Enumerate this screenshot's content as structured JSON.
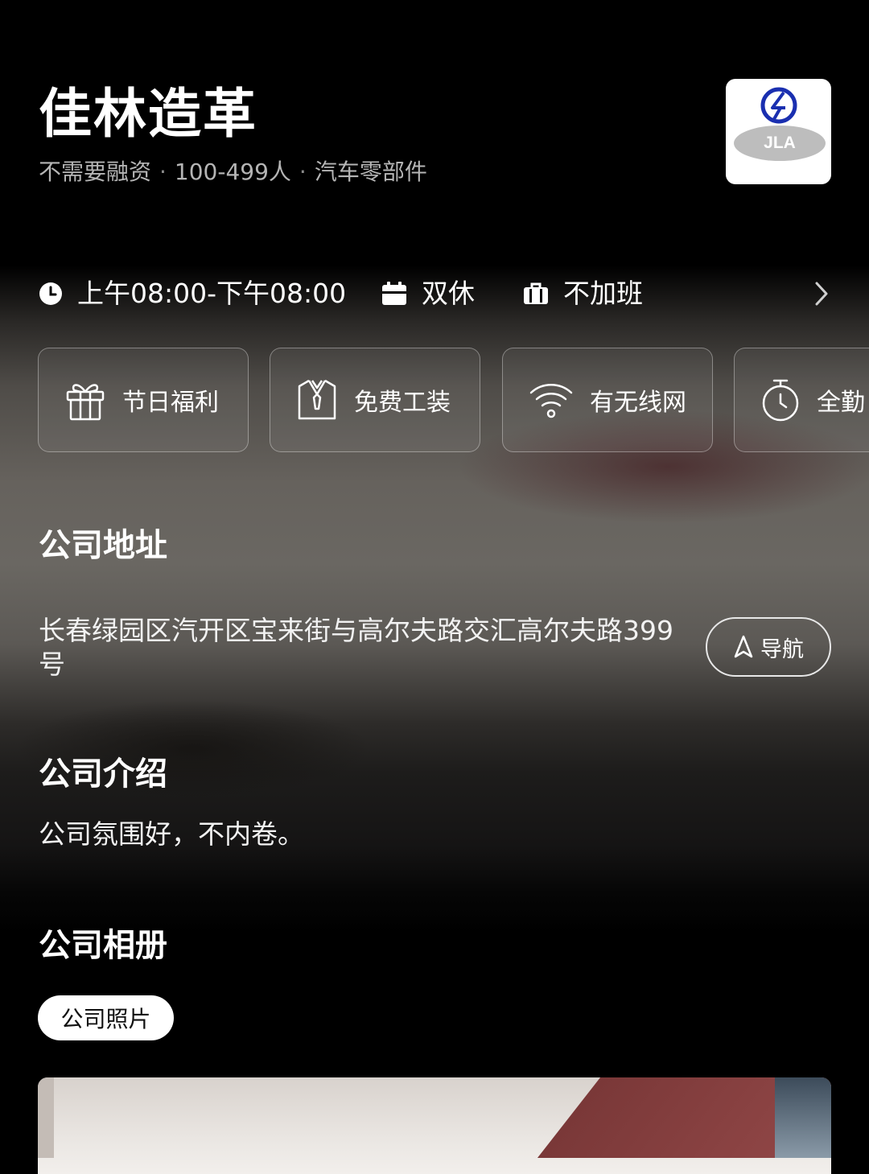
{
  "company": {
    "name": "佳林造革",
    "funding": "不需要融资",
    "size": "100-499人",
    "industry": "汽车零部件",
    "meta_separator": "·",
    "logo": {
      "text": "JLA",
      "icon": "jla-logo-icon",
      "brand_color": "#1a2fb0",
      "oval_color": "#bdbdbd"
    }
  },
  "work_info": {
    "hours": "上午08:00-下午08:00",
    "rest": "双休",
    "overtime": "不加班",
    "icons": [
      "clock-icon",
      "calendar-icon",
      "briefcase-icon",
      "chevron-right-icon"
    ]
  },
  "benefits": [
    {
      "label": "节日福利",
      "icon": "gift-icon"
    },
    {
      "label": "免费工装",
      "icon": "uniform-icon"
    },
    {
      "label": "有无线网",
      "icon": "wifi-icon"
    },
    {
      "label": "全勤",
      "icon": "stopwatch-icon"
    }
  ],
  "address_section": {
    "title": "公司地址",
    "address": "长春绿园区汽开区宝来街与高尔夫路交汇高尔夫路399号",
    "nav_label": "导航",
    "nav_icon": "navigation-arrow-icon"
  },
  "intro_section": {
    "title": "公司介绍",
    "text": "公司氛围好，不内卷。"
  },
  "album_section": {
    "title": "公司相册",
    "tab_label": "公司照片"
  },
  "colors": {
    "background": "#000000",
    "text": "#ffffff",
    "muted_text": "#b5b5b5",
    "tab_bg": "#ffffff"
  }
}
